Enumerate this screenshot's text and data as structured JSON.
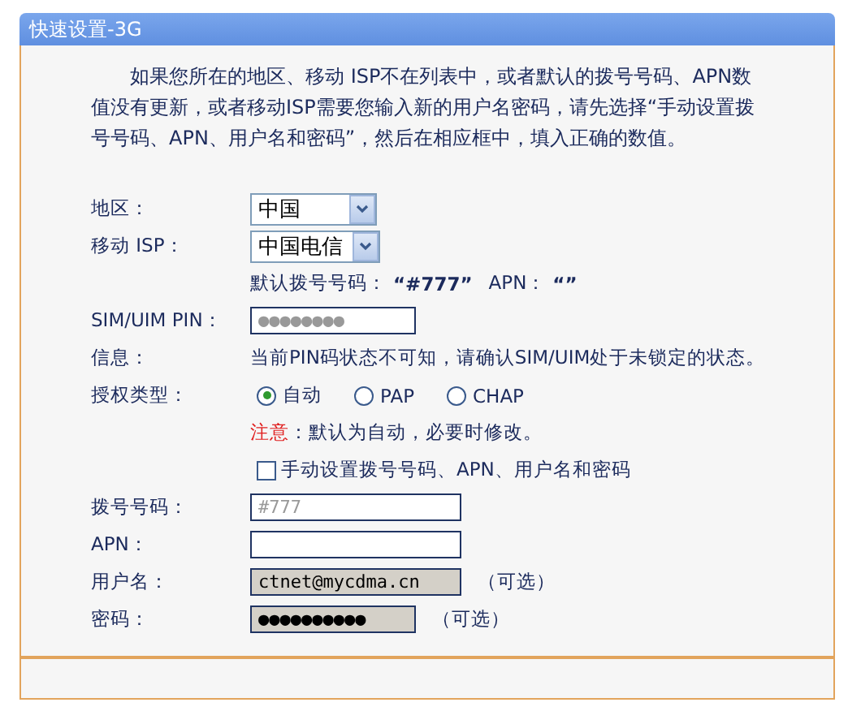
{
  "panel": {
    "title": "快速设置-3G"
  },
  "intro": "如果您所在的地区、移动 ISP不在列表中，或者默认的拨号号码、APN数值没有更新，或者移动ISP需要您输入新的用户名密码，请先选择“手动设置拨号号码、APN、用户名和密码”，然后在相应框中，填入正确的数值。",
  "rows": [
    {
      "kind": "select",
      "label": "地区：",
      "value": "中国"
    },
    {
      "kind": "select",
      "label": "移动 ISP：",
      "value": "中国电信"
    },
    {
      "kind": "hint",
      "label_1": "默认拨号号码：",
      "value_1": "“#777”",
      "label_2": "APN：",
      "value_2": "“”"
    },
    {
      "kind": "input",
      "label": "SIM/UIM PIN：",
      "placeholder": "●●●●●●●●",
      "readonly": false,
      "wide": false
    },
    {
      "kind": "text",
      "label": "信息：",
      "text": "当前PIN码状态不可知，请确认SIM/UIM处于未锁定的状态。"
    },
    {
      "kind": "radios",
      "label": "授权类型：",
      "options": [
        {
          "label": "自动",
          "selected": true
        },
        {
          "label": "PAP",
          "selected": false
        },
        {
          "label": "CHAP",
          "selected": false
        }
      ]
    },
    {
      "kind": "note",
      "label": "注意",
      "text": "：默认为自动，必要时修改。"
    },
    {
      "kind": "checkbox",
      "label": "手动设置拨号号码、APN、用户名和密码",
      "checked": false
    },
    {
      "kind": "input",
      "label": "拨号号码：",
      "placeholder": "#777",
      "readonly": false,
      "wide": true
    },
    {
      "kind": "input",
      "label": "APN：",
      "readonly": false,
      "wide": true
    },
    {
      "kind": "input",
      "label": "用户名：",
      "value": "ctnet@mycdma.cn",
      "readonly": true,
      "wide": true,
      "suffix": "（可选）"
    },
    {
      "kind": "input",
      "label": "密码：",
      "value": "●●●●●●●●●●",
      "readonly": true,
      "wide": false,
      "suffix": "（可选）"
    }
  ]
}
